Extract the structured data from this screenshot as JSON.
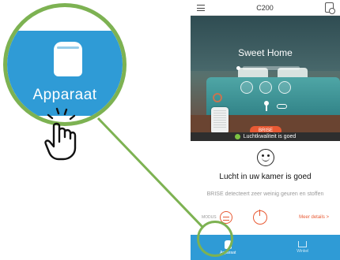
{
  "phone": {
    "title": "C200",
    "hero": {
      "home_name": "Sweet Home",
      "brise_button": "BRISE"
    },
    "quality_bar": "Luchtkwaliteit is goed",
    "status": {
      "title": "Lucht in uw kamer is goed",
      "description": "BRISE detecteert zeer weinig geuren en stoffen"
    },
    "controls": {
      "mode_label": "MODUS",
      "more_details": "Meer details >"
    },
    "bottom_nav": [
      {
        "label": "Apparaat",
        "icon": "purifier-icon",
        "active": true
      },
      {
        "label": "Winkel",
        "icon": "cart-icon",
        "active": false
      }
    ]
  },
  "callout": {
    "label": "Apparaat",
    "icon": "purifier-icon"
  },
  "colors": {
    "primary_blue": "#2f9bd6",
    "accent_orange": "#e85a34",
    "highlight_green": "#7db252",
    "good_green": "#7cc242"
  }
}
